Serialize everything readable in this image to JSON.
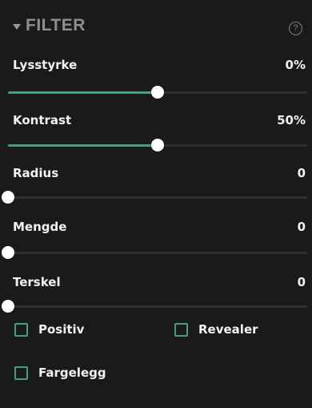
{
  "header": {
    "title": "FILTER"
  },
  "sliders": [
    {
      "label": "Lysstyrke",
      "value": "0%",
      "fill_fraction": 0.5
    },
    {
      "label": "Kontrast",
      "value": "50%",
      "fill_fraction": 0.5
    },
    {
      "label": "Radius",
      "value": "0",
      "fill_fraction": 0.0
    },
    {
      "label": "Mengde",
      "value": "0",
      "fill_fraction": 0.0
    },
    {
      "label": "Terskel",
      "value": "0",
      "fill_fraction": 0.0
    }
  ],
  "checkboxes": [
    {
      "label": "Positiv",
      "checked": false
    },
    {
      "label": "Revealer",
      "checked": false
    },
    {
      "label": "Fargelegg",
      "checked": false
    }
  ],
  "colors": {
    "accent": "#43a07c",
    "panel_bg": "#1a1a1a",
    "track": "#2f2f2f",
    "text": "#f2f2f2"
  },
  "icons": {
    "collapse": "chevron-down-icon",
    "help": "help-icon"
  }
}
